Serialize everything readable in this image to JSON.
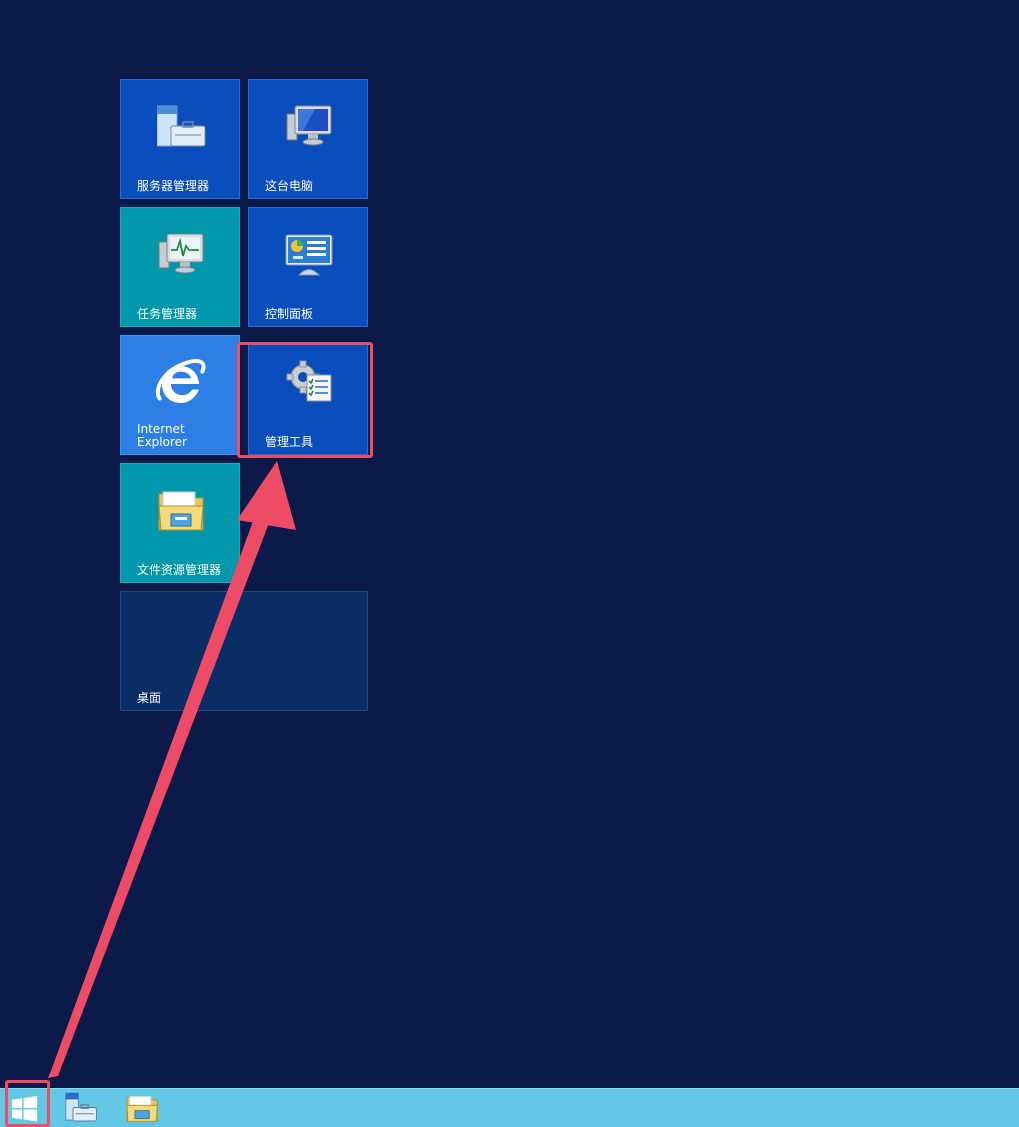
{
  "tiles": {
    "server_manager": "服务器管理器",
    "this_pc": "这台电脑",
    "task_manager": "任务管理器",
    "control_panel": "控制面板",
    "internet_explorer": "Internet\nExplorer",
    "admin_tools": "管理工具",
    "file_explorer": "文件资源管理器",
    "desktop": "桌面"
  },
  "icons": {
    "server_manager": "server-manager-icon",
    "this_pc": "computer-icon",
    "task_manager": "task-manager-icon",
    "control_panel": "control-panel-icon",
    "internet_explorer": "internet-explorer-icon",
    "admin_tools": "gear-checklist-icon",
    "file_explorer": "folder-icon",
    "start": "windows-logo-icon"
  },
  "colors": {
    "background": "#0b1a49",
    "tile_blue": "#0a4ebd",
    "tile_teal": "#0098aa",
    "tile_ie": "#2d7fe6",
    "tile_desktop": "#0b2d65",
    "taskbar": "#62c8e6",
    "annotation": "#ee4b67"
  }
}
